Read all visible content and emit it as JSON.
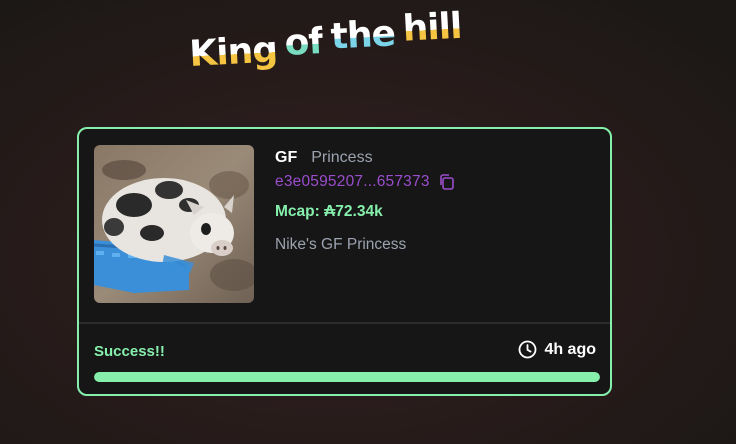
{
  "header": {
    "title_words": [
      "King",
      "of",
      "the",
      "hill"
    ]
  },
  "token": {
    "ticker": "GF",
    "name": "Princess",
    "address": "e3e0595207...657373",
    "mcap": "Mcap: ₳72.34k",
    "description": "Nike's GF Princess",
    "image_alt": "pig-in-blue-tub-photo"
  },
  "footer": {
    "status": "Success!!",
    "time": "4h ago",
    "progress_percent": 100
  },
  "colors": {
    "accent_green": "#86efac",
    "address_purple": "#9b4dcc",
    "card_bg": "#161616"
  },
  "icons": [
    "copy-icon",
    "clock-icon"
  ]
}
